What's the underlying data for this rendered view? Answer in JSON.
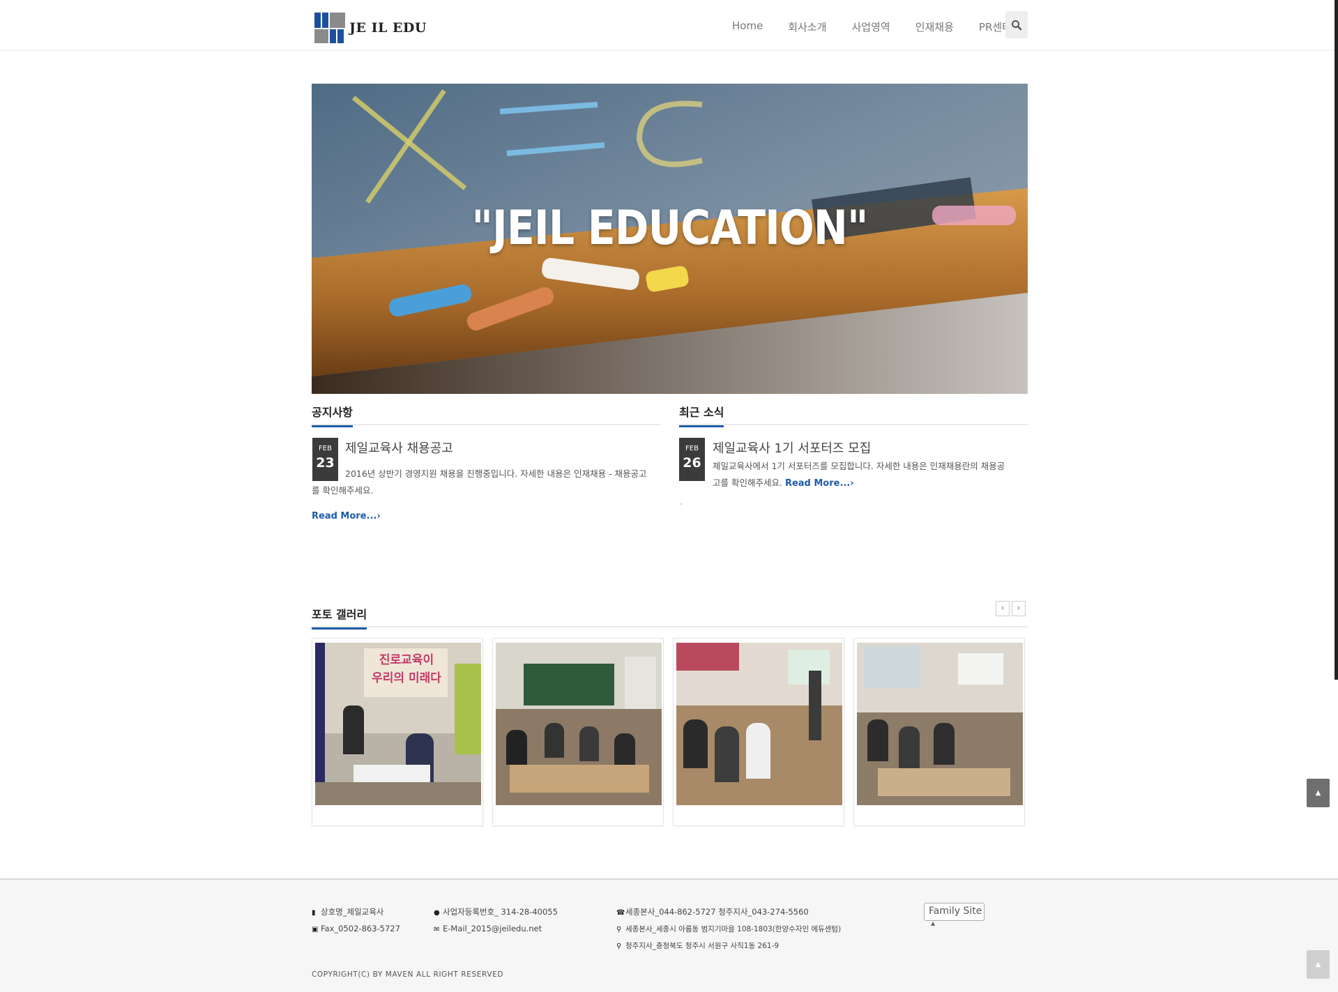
{
  "header": {
    "logo_text": "JE IL EDU",
    "nav": [
      "Home",
      "회사소개",
      "사업영역",
      "인재채용",
      "PR센터"
    ],
    "search_icon": "search-icon"
  },
  "hero": {
    "title": "\"JEIL EDUCATION\""
  },
  "notice": {
    "title": "공지사항",
    "post": {
      "month": "FEB",
      "day": "23",
      "title": "제일교육사 채용공고",
      "body_line1": "2016년 상반기 경영지원 채용을 진행중입니다. 자세한 내용은 인재채용 - 채용공고",
      "body_line2": "를 확인해주세요.",
      "readmore": "Read More...›"
    }
  },
  "news": {
    "title": "최근 소식",
    "post": {
      "month": "FEB",
      "day": "26",
      "title": "제일교육사 1기 서포터즈 모집",
      "body_line1": "제일교육사에서 1기 서포터즈를 모집합니다. 자세한 내용은 인재채용란의 채용공",
      "body_line2": "고를 확인해주세요.",
      "readmore": "Read More...›",
      "extra": "`"
    }
  },
  "gallery": {
    "title": "포토 갤러리",
    "prev": "‹",
    "next": "›",
    "photo1_caption": "진로교육이\n우리의 미래다"
  },
  "footer": {
    "company": "상호명_제일교육사",
    "fax": "Fax_0502-863-5727",
    "biz_no": "사업자등록번호_ 314-28-40055",
    "email": "E-Mail_2015@jeiledu.net",
    "phones": "세종본사_044-862-5727  청주지사_043-274-5560",
    "addr1": "세종본사_세종시 아름동 범지기마을 108-1803(한양수자인 에듀센텀)",
    "addr2": "청주지사_충청북도 청주시 서원구 사직1동 261-9",
    "family_site": "Family Site",
    "copyright": "COPYRIGHT(C) BY MAVEN ALL RIGHT RESERVED"
  },
  "colors": {
    "accent": "#1e5ba8",
    "date_box": "#3b3b3b"
  }
}
